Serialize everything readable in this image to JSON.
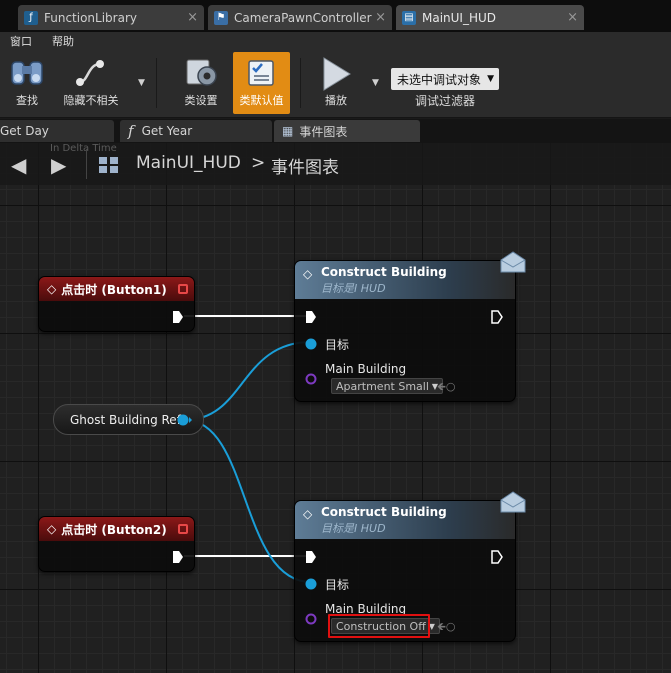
{
  "tabs": [
    {
      "label": "FunctionLibrary",
      "close": "×"
    },
    {
      "label": "CameraPawnController",
      "close": "×"
    },
    {
      "label": "MainUI_HUD",
      "close": "×"
    }
  ],
  "menu": [
    "窗口",
    "帮助"
  ],
  "toolbar": {
    "find": "查找",
    "hide_unrelated": "隐藏不相关",
    "class_settings": "类设置",
    "class_defaults": "类默认值",
    "play": "播放",
    "debug_select_value": "未选中调试对象",
    "debug_filter_label": "调试过滤器"
  },
  "function_tabs": [
    "Get Day",
    "Get Year",
    "事件图表"
  ],
  "breadcrumb": {
    "asset": "MainUI_HUD",
    "separator": ">",
    "graph": "事件图表",
    "faint_label": "In Delta Time"
  },
  "nodes": {
    "event1": {
      "title": "点击时 (Button1)"
    },
    "event2": {
      "title": "点击时 (Button2)"
    },
    "construct1": {
      "title": "Construct Building",
      "subtitle": "目标是I HUD",
      "target_label": "目标",
      "param_label": "Main Building",
      "param_value": "Apartment Small"
    },
    "construct2": {
      "title": "Construct Building",
      "subtitle": "目标是I HUD",
      "target_label": "目标",
      "param_label": "Main Building",
      "param_value": "Construction Off"
    },
    "ghost": {
      "label": "Ghost Building Ref"
    }
  },
  "colors": {
    "accent_orange": "#e28c14",
    "event_red": "#8c1818",
    "wire_blue": "#1a9ed8",
    "highlight_box": "#e01010"
  }
}
